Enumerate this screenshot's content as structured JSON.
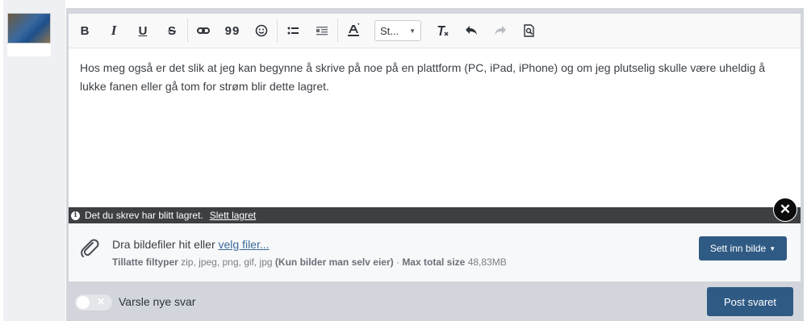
{
  "toolbar": {
    "bold": "B",
    "italic": "I",
    "underline": "U",
    "strike": "S",
    "quote": "99",
    "style_select": "St..."
  },
  "editor": {
    "content": "Hos meg også er det slik at jeg kan begynne å skrive på noe på en plattform (PC, iPad, iPhone) og om jeg plutselig skulle være uheldig å lukke fanen eller gå tom for strøm blir dette lagret."
  },
  "draft_bar": {
    "message": "Det du skrev har blitt lagret.",
    "delete_link": "Slett lagret"
  },
  "upload": {
    "drop_text": "Dra bildefiler hit eller",
    "choose_link": "velg filer...",
    "allowed_label": "Tillatte filtyper",
    "allowed_types": "zip, jpeg, png, gif, jpg",
    "own_images_note": "(Kun bilder man selv eier)",
    "separator": "·",
    "max_size_label": "Max total size",
    "max_size_value": "48,83MB",
    "insert_image_button": "Sett inn bilde"
  },
  "footer": {
    "notify_label": "Varsle nye svar",
    "post_button": "Post svaret"
  },
  "colors": {
    "accent": "#2f5a84",
    "draft_bar": "#3d4043",
    "frame": "#d2d6dc"
  }
}
